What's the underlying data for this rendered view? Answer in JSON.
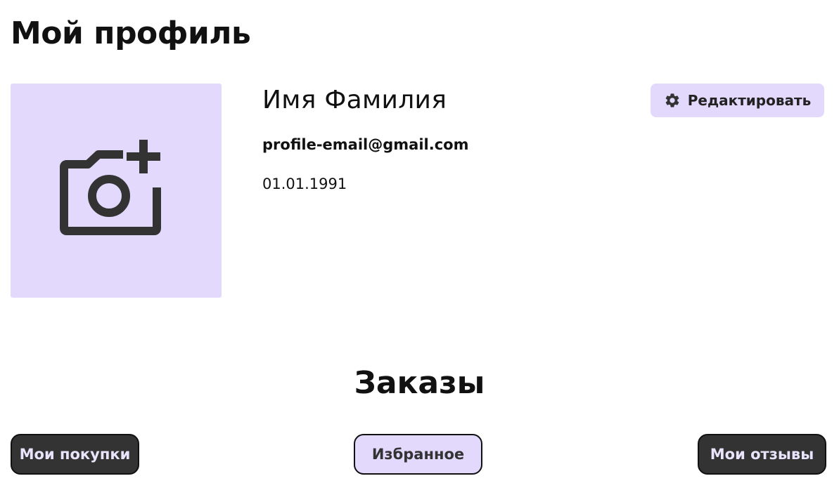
{
  "page": {
    "title": "Мой профиль"
  },
  "profile": {
    "avatar_icon": "add-photo-camera-icon",
    "name": "Имя Фамилия",
    "email": "profile-email@gmail.com",
    "birth_date": "01.01.1991"
  },
  "edit_button": {
    "label": "Редактировать",
    "icon": "gear-icon"
  },
  "orders": {
    "title": "Заказы",
    "tabs": [
      {
        "label": "Мои покупки",
        "active": false
      },
      {
        "label": "Избранное",
        "active": true
      },
      {
        "label": "Мои отзывы",
        "active": false
      }
    ]
  },
  "colors": {
    "accent_light": "#e2d9fd",
    "dark_button": "#333333",
    "text": "#111111"
  }
}
